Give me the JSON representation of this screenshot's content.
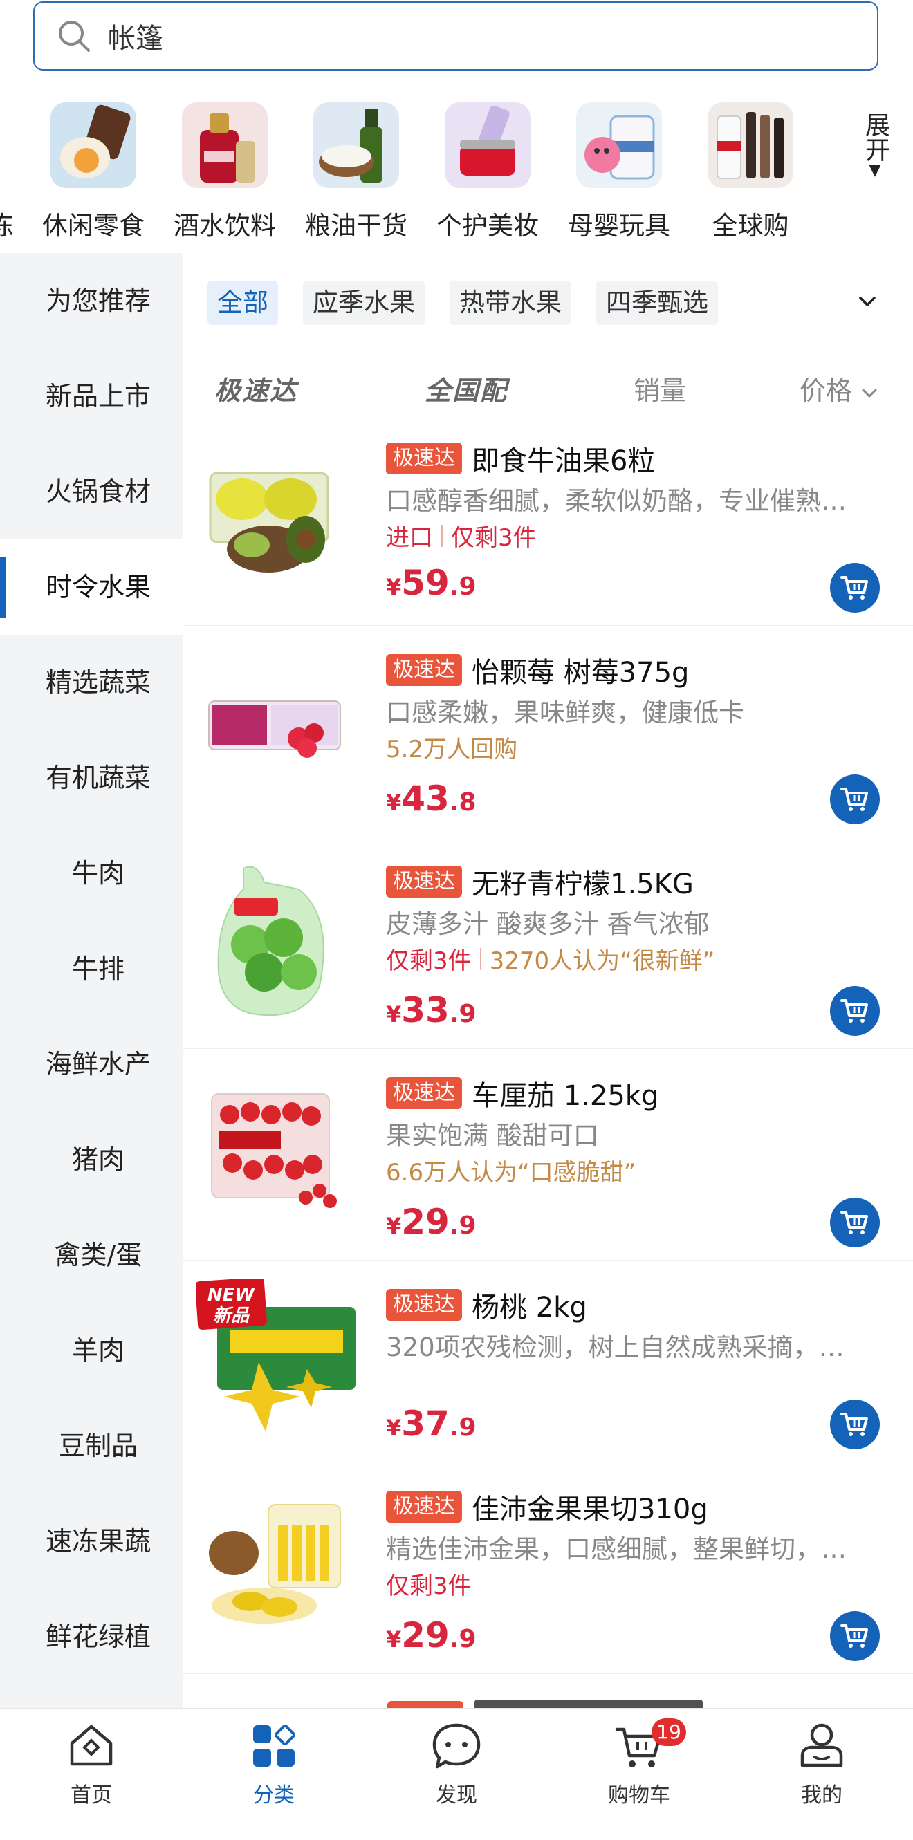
{
  "search": {
    "query": "帐篷"
  },
  "categories": {
    "partial_label": "冻",
    "items": [
      {
        "label": "休闲零食",
        "icon": "snacks-icon"
      },
      {
        "label": "酒水饮料",
        "icon": "beverage-icon"
      },
      {
        "label": "粮油干货",
        "icon": "grain-oil-icon"
      },
      {
        "label": "个护美妆",
        "icon": "cosmetics-icon"
      },
      {
        "label": "母婴玩具",
        "icon": "baby-toys-icon"
      },
      {
        "label": "全球购",
        "icon": "global-shopping-icon"
      }
    ],
    "expand_label": "展开"
  },
  "sidebar": {
    "items": [
      {
        "label": "为您推荐"
      },
      {
        "label": "新品上市"
      },
      {
        "label": "火锅食材"
      },
      {
        "label": "时令水果",
        "active": true
      },
      {
        "label": "精选蔬菜"
      },
      {
        "label": "有机蔬菜"
      },
      {
        "label": "牛肉"
      },
      {
        "label": "牛排"
      },
      {
        "label": "海鲜水产"
      },
      {
        "label": "猪肉"
      },
      {
        "label": "禽类/蛋"
      },
      {
        "label": "羊肉"
      },
      {
        "label": "豆制品"
      },
      {
        "label": "速冻果蔬"
      },
      {
        "label": "鲜花绿植"
      }
    ]
  },
  "filters": {
    "chips": [
      "全部",
      "应季水果",
      "热带水果",
      "四季甄选"
    ],
    "active": "全部"
  },
  "sort": {
    "speed_delivery": "极速达",
    "nationwide": "全国配",
    "sales": "销量",
    "price": "价格"
  },
  "products": [
    {
      "badge": "极速达",
      "name": "即食牛油果6粒",
      "desc": "口感醇香细腻，柔软似奶酪，专业催熟…",
      "tags": [
        {
          "text": "进口",
          "color": "red"
        },
        {
          "text": "仅剩3件",
          "color": "red"
        }
      ],
      "price_cur": "¥",
      "price_int": "59",
      "price_dec": ".9"
    },
    {
      "badge": "极速达",
      "name": "怡颗莓 树莓375g",
      "desc": "口感柔嫩，果味鲜爽，健康低卡",
      "tags": [
        {
          "text": "5.2万人回购",
          "color": "brown"
        }
      ],
      "price_cur": "¥",
      "price_int": "43",
      "price_dec": ".8"
    },
    {
      "badge": "极速达",
      "name": "无籽青柠檬1.5KG",
      "desc": "皮薄多汁 酸爽多汁 香气浓郁",
      "tags": [
        {
          "text": "仅剩3件",
          "color": "red"
        },
        {
          "text": "3270人认为“很新鲜”",
          "color": "brown"
        }
      ],
      "price_cur": "¥",
      "price_int": "33",
      "price_dec": ".9"
    },
    {
      "badge": "极速达",
      "name": "车厘茄 1.25kg",
      "desc": "果实饱满 酸甜可口",
      "tags": [
        {
          "text": "6.6万人认为“口感脆甜”",
          "color": "brown"
        }
      ],
      "price_cur": "¥",
      "price_int": "29",
      "price_dec": ".9"
    },
    {
      "badge": "极速达",
      "name": "杨桃 2kg",
      "desc": "320项农残检测，树上自然成熟采摘，…",
      "image_tag": "NEW 新品",
      "tags": [],
      "price_cur": "¥",
      "price_int": "37",
      "price_dec": ".9"
    },
    {
      "badge": "极速达",
      "name": "佳沛金果果切310g",
      "desc": "精选佳沛金果，口感细腻，整果鲜切，…",
      "tags": [
        {
          "text": "仅剩3件",
          "color": "red"
        }
      ],
      "price_cur": "¥",
      "price_int": "29",
      "price_dec": ".9"
    }
  ],
  "nav": {
    "home": "首页",
    "category": "分类",
    "discover": "发现",
    "cart": "购物车",
    "cart_count": "19",
    "mine": "我的"
  },
  "colors": {
    "accent": "#1563b8",
    "price": "#d7263d",
    "badge": "#e8553b"
  }
}
